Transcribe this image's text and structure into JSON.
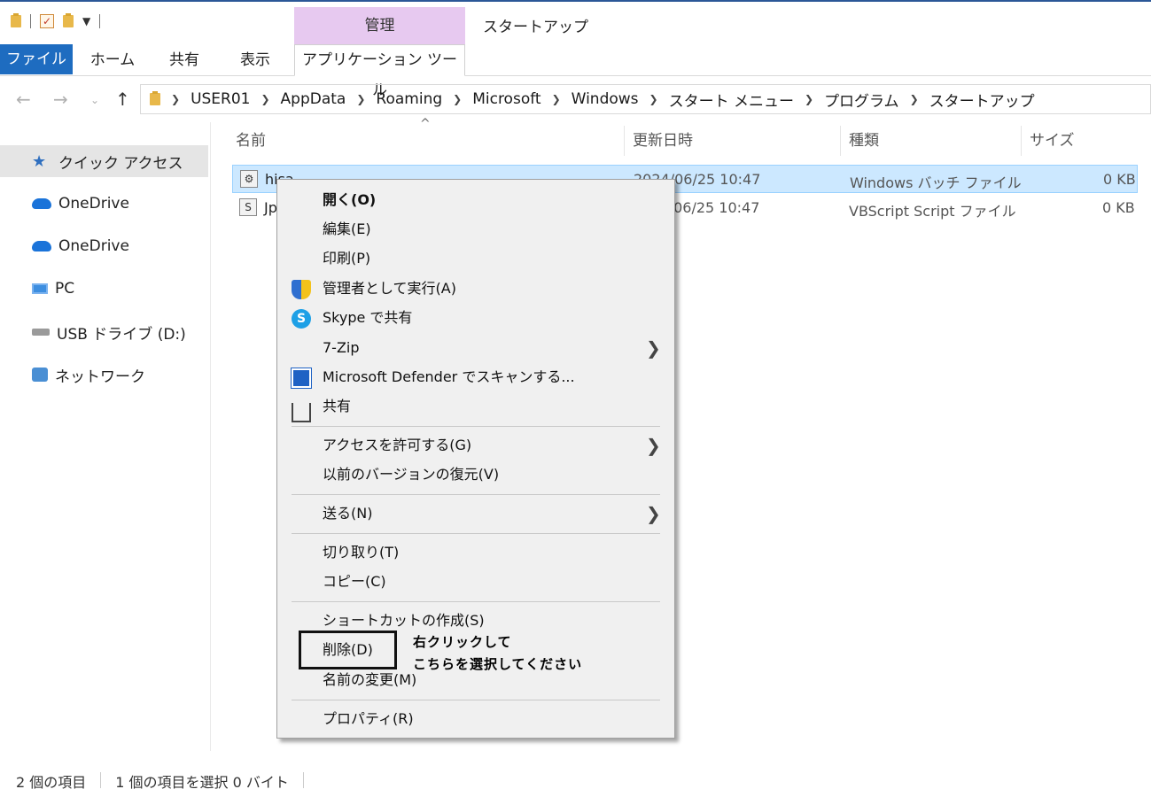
{
  "titlebar": {
    "manage_tab": "管理",
    "title": "スタートアップ"
  },
  "ribbon": {
    "tabs": [
      "ファイル",
      "ホーム",
      "共有",
      "表示",
      "アプリケーション ツール"
    ]
  },
  "address": {
    "path": [
      "USER01",
      "AppData",
      "Roaming",
      "Microsoft",
      "Windows",
      "スタート メニュー",
      "プログラム",
      "スタートアップ"
    ]
  },
  "navpane": {
    "items": [
      "クイック アクセス",
      "OneDrive",
      "OneDrive",
      "PC",
      "USB ドライブ (D:)",
      "ネットワーク"
    ]
  },
  "filelist": {
    "columns": [
      "名前",
      "更新日時",
      "種類",
      "サイズ"
    ],
    "rows": [
      {
        "name": "hisa",
        "date": "2024/06/25 10:47",
        "type": "Windows バッチ ファイル",
        "size": "0 KB"
      },
      {
        "name": "Jp",
        "date": "2024/06/25 10:47",
        "type": "VBScript Script ファイル",
        "size": "0 KB"
      }
    ]
  },
  "status": {
    "count": "2 個の項目",
    "selection": "1 個の項目を選択  0 バイト"
  },
  "context_menu": {
    "items": [
      "開く(O)",
      "編集(E)",
      "印刷(P)",
      "管理者として実行(A)",
      "Skype で共有",
      "7-Zip",
      "Microsoft Defender でスキャンする...",
      "共有",
      "アクセスを許可する(G)",
      "以前のバージョンの復元(V)",
      "送る(N)",
      "切り取り(T)",
      "コピー(C)",
      "ショートカットの作成(S)",
      "削除(D)",
      "名前の変更(M)",
      "プロパティ(R)"
    ]
  },
  "annotation": {
    "line1": "右クリックして",
    "line2": "こちらを選択してください"
  }
}
